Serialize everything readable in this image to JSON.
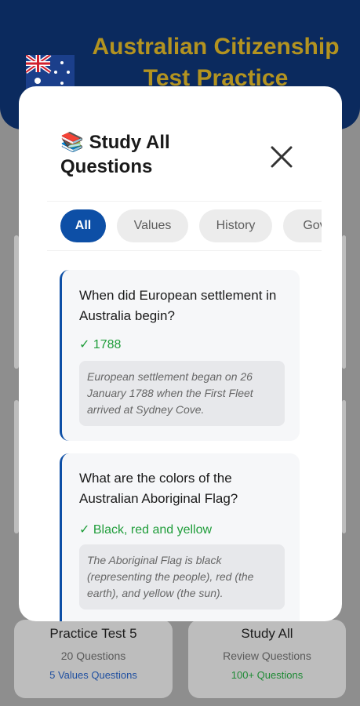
{
  "app": {
    "title": "Australian Citizenship Test Practice",
    "cards": [
      {
        "title": "Practice Test 5",
        "subtitle": "20 Questions",
        "meta": "5 Values Questions",
        "meta_color": "#1f4fa0"
      },
      {
        "title": "Study All",
        "subtitle": "Review Questions",
        "meta": "100+ Questions",
        "meta_color": "#1e8a35"
      }
    ]
  },
  "modal": {
    "title_emoji": "📚",
    "title": "Study All Questions",
    "close_icon": "close-icon",
    "chips": [
      {
        "label": "All",
        "active": true
      },
      {
        "label": "Values",
        "active": false
      },
      {
        "label": "History",
        "active": false
      },
      {
        "label": "Gov",
        "active": false
      }
    ],
    "questions": [
      {
        "question": "When did European settlement in Australia begin?",
        "answer": "✓ 1788",
        "explanation": "European settlement began on 26 January 1788 when the First Fleet arrived at Sydney Cove."
      },
      {
        "question": "What are the colors of the Australian Aboriginal Flag?",
        "answer": "✓ Black, red and yellow",
        "explanation": "The Aboriginal Flag is black (representing the people), red (the earth), and yellow (the sun)."
      }
    ]
  },
  "colors": {
    "header_bg": "#0b2a5e",
    "title_gold": "#b39320",
    "accent_blue": "#0d4fa6",
    "answer_green": "#1f9d3a"
  }
}
